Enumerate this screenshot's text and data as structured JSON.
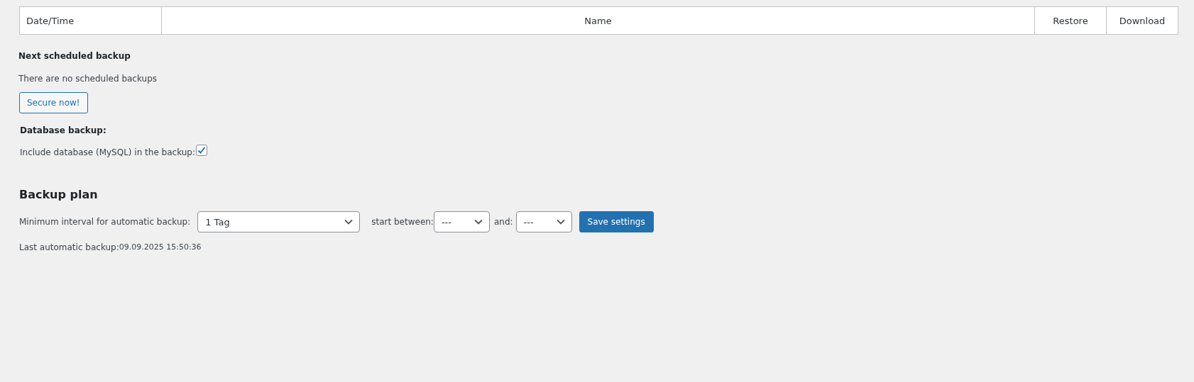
{
  "table": {
    "columns": [
      {
        "label": "Date/Time"
      },
      {
        "label": "Name"
      },
      {
        "label": "Restore"
      },
      {
        "label": "Download"
      }
    ]
  },
  "next_backup": {
    "heading": "Next scheduled backup",
    "message": "There are no scheduled backups",
    "button": "Secure now!"
  },
  "database": {
    "heading": "Database backup:",
    "include_label": "Include database (MySQL) in the backup:",
    "checked": true
  },
  "plan": {
    "heading": "Backup plan",
    "interval_label": "Minimum interval for automatic backup:",
    "interval_value": "1 Tag",
    "start_label": "start between:",
    "start_value": "---",
    "end_label": "and:",
    "end_value": "---",
    "save_button": "Save settings",
    "last_label": "Last automatic backup:",
    "last_value": "09.09.2025 15:50:36"
  }
}
